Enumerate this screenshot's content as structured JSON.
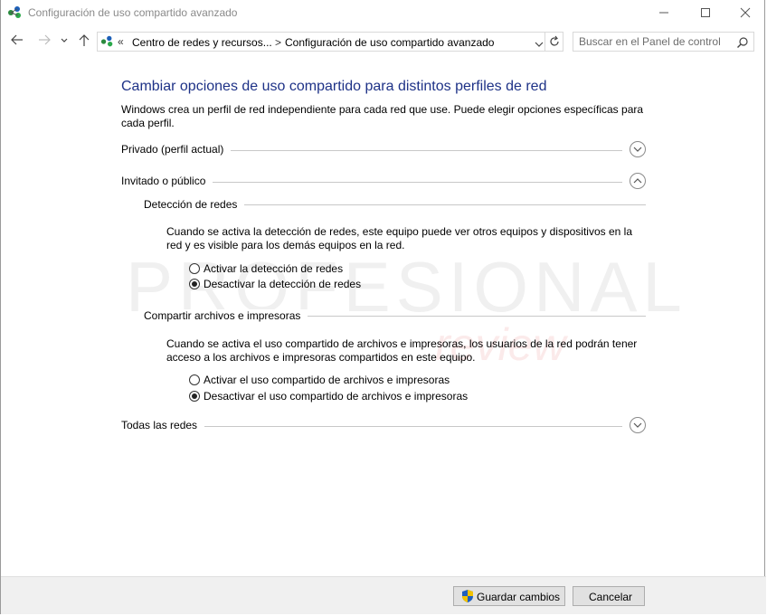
{
  "window": {
    "title": "Configuración de uso compartido avanzado"
  },
  "address_bar": {
    "overflow": "«",
    "crumbs": [
      "Centro de redes y recursos...",
      "Configuración de uso compartido avanzado"
    ],
    "separator": ">"
  },
  "search": {
    "placeholder": "Buscar en el Panel de control"
  },
  "content": {
    "heading": "Cambiar opciones de uso compartido para distintos perfiles de red",
    "description": "Windows crea un perfil de red independiente para cada red que use. Puede elegir opciones específicas para cada perfil.",
    "profiles": [
      {
        "label": "Privado (perfil actual)",
        "expanded": false
      },
      {
        "label": "Invitado o público",
        "expanded": true
      },
      {
        "label": "Todas las redes",
        "expanded": false
      }
    ],
    "network_discovery": {
      "title": "Detección de redes",
      "text": "Cuando se activa la detección de redes, este equipo puede ver otros equipos y dispositivos en la red y es visible para los demás equipos en la red.",
      "options": [
        {
          "label": "Activar la detección de redes",
          "selected": false
        },
        {
          "label": "Desactivar la detección de redes",
          "selected": true
        }
      ]
    },
    "file_sharing": {
      "title": "Compartir archivos e impresoras",
      "text": "Cuando se activa el uso compartido de archivos e impresoras, los usuarios de la red podrán tener acceso a los archivos e impresoras compartidos en este equipo.",
      "options": [
        {
          "label": "Activar el uso compartido de archivos e impresoras",
          "selected": false
        },
        {
          "label": "Desactivar el uso compartido de archivos e impresoras",
          "selected": true
        }
      ]
    }
  },
  "watermark": {
    "text": "PROFESIONAL",
    "subtext": "review"
  },
  "footer": {
    "save_label": "Guardar cambios",
    "cancel_label": "Cancelar"
  },
  "colors": {
    "heading": "#1e3287",
    "footer_bg": "#f0f0f0",
    "shield_blue": "#1f5fbf",
    "shield_yellow": "#f2c200"
  },
  "icons": {
    "title": "network-sharing-icon",
    "back": "arrow-left-icon",
    "forward": "arrow-right-icon",
    "recent": "chevron-down-icon",
    "up": "arrow-up-icon",
    "refresh": "refresh-icon",
    "search": "magnifier-icon",
    "save": "uac-shield-icon"
  }
}
